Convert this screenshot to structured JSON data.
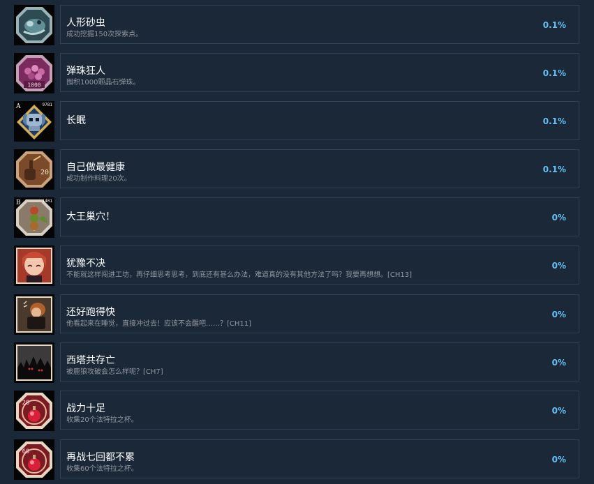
{
  "achievements": [
    {
      "title": "人形砂虫",
      "desc": "成功挖掘150次探索点。",
      "percent": "0.1%",
      "icon": "sandworm-icon"
    },
    {
      "title": "弹珠狂人",
      "desc": "囤积1000颗晶石弹珠。",
      "percent": "0.1%",
      "icon": "marbles-icon"
    },
    {
      "title": "长眠",
      "desc": "",
      "percent": "0.1%",
      "icon": "skull-knight-icon"
    },
    {
      "title": "自己做最健康",
      "desc": "成功制作料理20次。",
      "percent": "0.1%",
      "icon": "cooking-hand-icon"
    },
    {
      "title": "大王巢穴！",
      "desc": "",
      "percent": "0%",
      "icon": "skewer-icon"
    },
    {
      "title": "犹豫不决",
      "desc": "不能就这样闯进工坊，再仔细思考思考，到底还有甚么办法，难道真的没有其他方法了吗？我要再想想。[CH13]",
      "percent": "0%",
      "icon": "red-hair-girl-icon"
    },
    {
      "title": "还好跑得快",
      "desc": "他看起来在睡觉，直接冲过去！应该不会醒吧……？[CH11]",
      "percent": "0%",
      "icon": "sleeping-figure-icon"
    },
    {
      "title": "西塔共存亡",
      "desc": "被鹿狼攻破会怎么样呢？[CH7]",
      "percent": "0%",
      "icon": "dark-forest-icon"
    },
    {
      "title": "战力十足",
      "desc": "收集20个法特拉之杯。",
      "percent": "0%",
      "icon": "red-potion-20-icon"
    },
    {
      "title": "再战七回都不累",
      "desc": "收集60个法特拉之杯。",
      "percent": "0%",
      "icon": "red-potion-60-icon"
    }
  ],
  "icon_badges": {
    "marbles": "1000",
    "skull_corner": "A",
    "skull_count": "9781",
    "skewer_corner": "B",
    "skewer_count": "1401",
    "cooking": "20",
    "potion20": "20",
    "potion60": "60"
  },
  "colors": {
    "background": "#1b2838",
    "border": "#2f4153",
    "title": "#ffffff",
    "desc": "#8f98a0",
    "percent": "#66c0f4"
  }
}
